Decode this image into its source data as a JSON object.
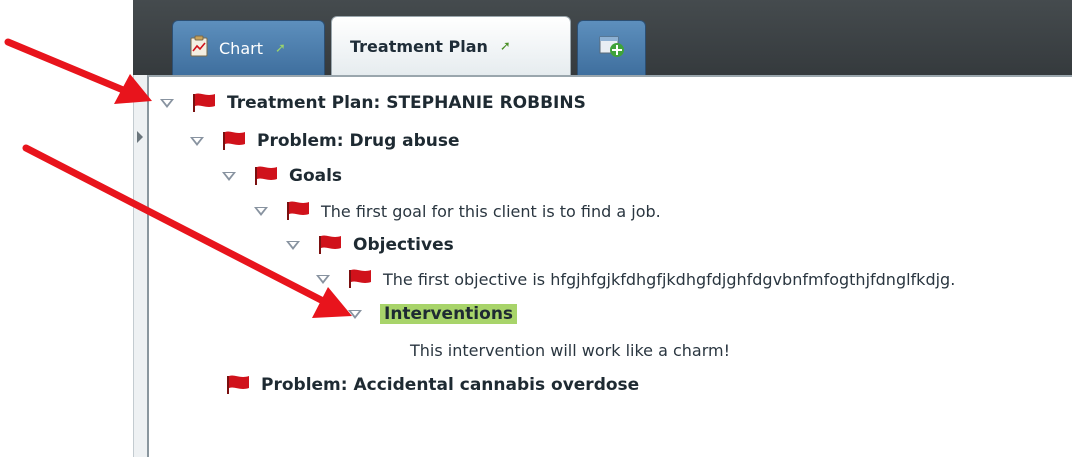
{
  "tabs": [
    {
      "label": "Chart",
      "icon": "clipboard-chart-icon",
      "pin": "pin-icon"
    },
    {
      "label": "Treatment Plan",
      "icon": "",
      "pin": "pin-icon"
    },
    {
      "label": "",
      "icon": "add-tab-icon"
    }
  ],
  "tree": {
    "plan_title": "Treatment Plan: STEPHANIE ROBBINS",
    "problem1": "Problem: Drug abuse",
    "goals": "Goals",
    "goal1": "The first goal for this client is to find a job.",
    "objectives": "Objectives",
    "objective1": "The first objective is hfgjhfgjkfdhgfjkdhgfdjghfdgvbnfmfogthjfdnglfkdjg.",
    "interventions": "Interventions",
    "intervention1": "This intervention will work like a charm!",
    "problem2": "Problem: Accidental cannabis overdose"
  },
  "colors": {
    "flag": "#d0121b",
    "annotation_arrow": "#e8141c",
    "highlight": "#a8d46a"
  }
}
